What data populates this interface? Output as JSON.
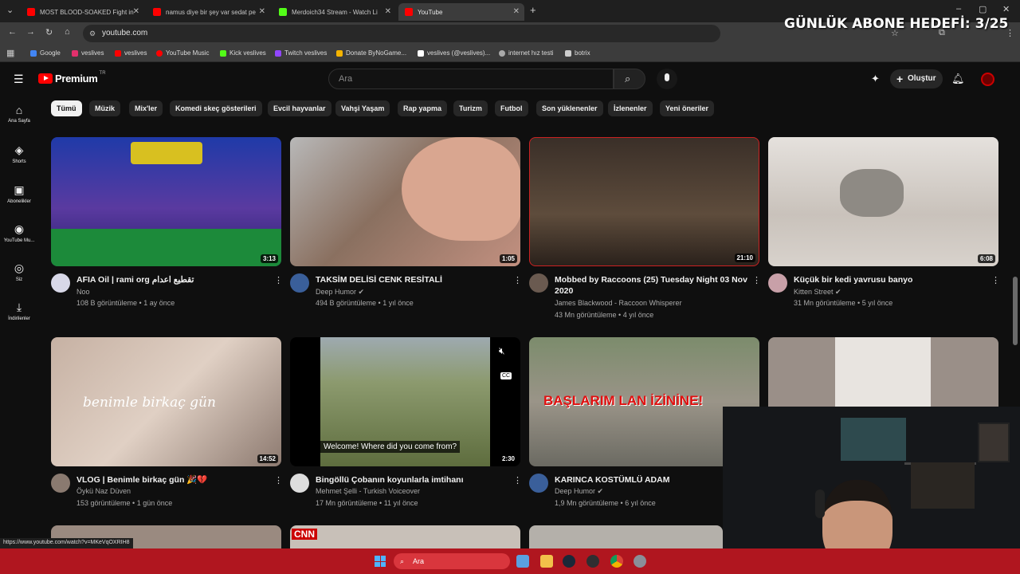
{
  "tabs": [
    {
      "title": "MOST BLOOD-SOAKED Fight in",
      "color": "#ff0000"
    },
    {
      "title": "namus diye bir şey var sedat pe",
      "color": "#ff0000"
    },
    {
      "title": "Merdoich34 Stream - Watch Li",
      "color": "#53fc18"
    },
    {
      "title": "YouTube",
      "color": "#ff0000"
    }
  ],
  "address": "youtube.com",
  "bookmarks": [
    {
      "label": "Google",
      "color": "#4285f4"
    },
    {
      "label": "veslives",
      "color": "#e1306c"
    },
    {
      "label": "veslives",
      "color": "#ff0000"
    },
    {
      "label": "YouTube Music",
      "color": "#ff0000"
    },
    {
      "label": "Kick veslives",
      "color": "#53fc18"
    },
    {
      "label": "Twitch veslives",
      "color": "#9146ff"
    },
    {
      "label": "Donate ByNoGame...",
      "color": "#f5b400"
    },
    {
      "label": "veslives (@veslives)...",
      "color": "#ffffff"
    },
    {
      "label": "internet hız testi",
      "color": "#cccccc"
    },
    {
      "label": "botrix",
      "color": "#cccccc"
    }
  ],
  "overlay_text": "GÜNLÜK ABONE HEDEFİ: 3/25",
  "youtube": {
    "logo": "Premium",
    "logo_sup": "TR",
    "search_placeholder": "Ara",
    "create_label": "Oluştur",
    "sidebar": [
      "Ana Sayfa",
      "Shorts",
      "Abonelikler",
      "YouTube Mu...",
      "Siz",
      "İndirilenler"
    ],
    "chips": [
      "Tümü",
      "Müzik",
      "Mix'ler",
      "Komedi skeç gösterileri",
      "Evcil hayvanlar",
      "Vahşi Yaşam",
      "Rap yapma",
      "Turizm",
      "Futbol",
      "Son yüklenenler",
      "İzlenenler",
      "Yeni öneriler"
    ],
    "videos": [
      {
        "title": "AFIA Oil | rami org تقطيع اعدام",
        "channel": "Noo",
        "meta": "108 B görüntüleme • 1 ay önce",
        "duration": "3:13",
        "thumb": "#2b3fae",
        "avatar": "#d8d8e8",
        "verified": false
      },
      {
        "title": "TAKSİM DELİSİ CENK RESİTALİ",
        "channel": "Deep Humor",
        "meta": "494 B görüntüleme • 1 yıl önce",
        "duration": "1:05",
        "thumb": "#8a7a6e",
        "avatar": "#3a5f9a",
        "verified": true
      },
      {
        "title": "Mobbed by Raccoons  (25)   Tuesday Night 03 Nov",
        "title2": "2020",
        "channel": "James Blackwood - Raccoon Whisperer",
        "meta": "43 Mn görüntüleme • 4 yıl önce",
        "duration": "21:10",
        "thumb": "#4a3d33",
        "avatar": "#6a5a50",
        "verified": false
      },
      {
        "title": "Küçük bir kedi yavrusu banyo",
        "channel": "Kitten Street",
        "meta": "31 Mn görüntüleme • 5 yıl önce",
        "duration": "6:08",
        "thumb": "#c8c2bc",
        "avatar": "#c8a0a8",
        "verified": true
      },
      {
        "title": "VLOG | Benimle birkaç gün 🎉💔",
        "channel": "Öykü Naz Düven",
        "meta": "153 görüntüleme • 1 gün önce",
        "duration": "14:52",
        "thumb": "#bda89a",
        "avatar": "#8a7a70",
        "verified": false
      },
      {
        "title": "Bingöllü Çobanın koyunlarla imtihanı",
        "channel": "Mehmet Şelli - Turkish Voiceover",
        "meta": "17 Mn görüntüleme • 11 yıl önce",
        "duration": "2:30",
        "thumb": "#6f7a52",
        "avatar": "#ddd",
        "verified": false,
        "caption": "Welcome! Where did you come from?"
      },
      {
        "title": "KARINCA KOSTÜMLÜ ADAM",
        "channel": "Deep Humor",
        "meta": "1,9 Mn görüntüleme • 6 yıl önce",
        "duration": "",
        "thumb": "#8c8a7c",
        "avatar": "#3a5f9a",
        "verified": true,
        "caption": "BAŞLARIM LAN İZİNİNE!"
      },
      {
        "title": "",
        "channel": "",
        "meta": "",
        "duration": "",
        "thumb": "#9a8f88",
        "avatar": "#000",
        "verified": false
      }
    ]
  },
  "status_url": "https://www.youtube.com/watch?v=MKeVqOXRIH8",
  "taskbar": {
    "search_label": "Ara"
  }
}
